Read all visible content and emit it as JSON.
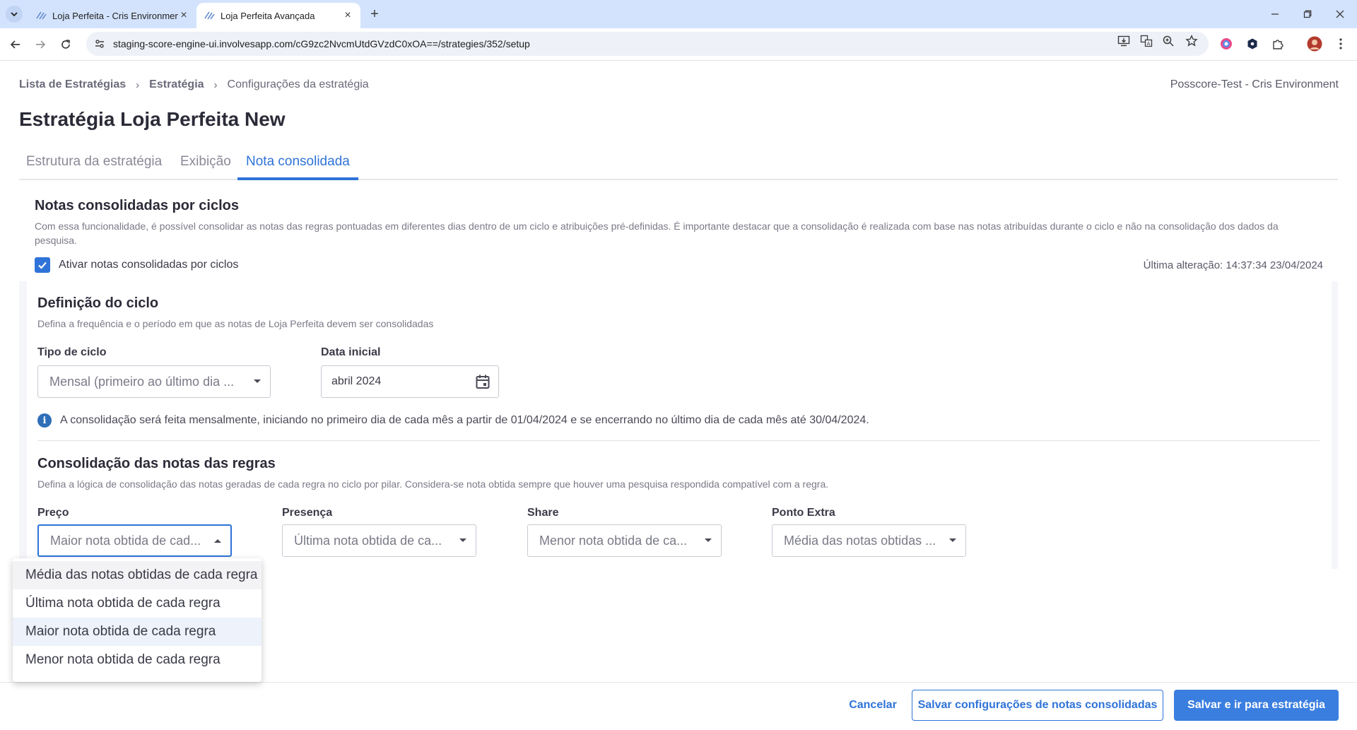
{
  "browser": {
    "tabs": [
      {
        "title": "Loja Perfeita - Cris Environment",
        "active": false
      },
      {
        "title": "Loja Perfeita Avançada",
        "active": true
      }
    ],
    "url": "staging-score-engine-ui.involvesapp.com/cG9zc2NvcmUtdGVzdC0xOA==/strategies/352/setup"
  },
  "breadcrumb": {
    "items": [
      "Lista de Estratégias",
      "Estratégia",
      "Configurações da estratégia"
    ],
    "separator": "›"
  },
  "environment": "Posscore-Test - Cris Environment",
  "page_title": "Estratégia Loja Perfeita New",
  "tabs": [
    "Estrutura da estratégia",
    "Exibição",
    "Nota consolidada"
  ],
  "active_tab": "Nota consolidada",
  "consolidated": {
    "title": "Notas consolidadas por ciclos",
    "description": "Com essa funcionalidade, é possível consolidar as notas das regras pontuadas em diferentes dias dentro de um ciclo e atribuições pré-definidas. É importante destacar que a consolidação é realizada com base nas notas atribuídas durante o ciclo e não na consolidação dos dados da pesquisa.",
    "checkbox_label": "Ativar notas consolidadas por ciclos",
    "checkbox_checked": true,
    "last_change": "Última alteração: 14:37:34 23/04/2024"
  },
  "cycle": {
    "title": "Definição do ciclo",
    "description": "Defina a frequência e o período em que as notas de Loja Perfeita devem ser consolidadas",
    "type_label": "Tipo de ciclo",
    "type_value": "Mensal (primeiro ao último dia ...",
    "date_label": "Data inicial",
    "date_value": "abril 2024",
    "info": "A consolidação será feita mensalmente, iniciando no primeiro dia de cada mês a partir de 01/04/2024 e se encerrando no último dia de cada mês até 30/04/2024."
  },
  "rules": {
    "title": "Consolidação das notas das regras",
    "description": "Defina a lógica de consolidação das notas geradas de cada regra no ciclo por pilar. Considera-se nota obtida sempre que houver uma pesquisa respondida compatível com a regra.",
    "fields": [
      {
        "label": "Preço",
        "value": "Maior nota obtida de cad..."
      },
      {
        "label": "Presença",
        "value": "Última nota obtida de ca..."
      },
      {
        "label": "Share",
        "value": "Menor nota obtida de ca..."
      },
      {
        "label": "Ponto Extra",
        "value": "Média das notas obtidas ..."
      }
    ]
  },
  "dropdown_options": [
    "Média das notas obtidas de cada regra",
    "Última nota obtida de cada regra",
    "Maior nota obtida de cada regra",
    "Menor nota obtida de cada regra"
  ],
  "dropdown_selected": "Maior nota obtida de cada regra",
  "footer": {
    "cancel": "Cancelar",
    "save_config": "Salvar configurações de notas consolidadas",
    "save_go": "Salvar e ir para estratégia"
  },
  "colors": {
    "accent": "#2f73d8",
    "tabbar": "#d3e3fd",
    "info": "#2f6fb8"
  }
}
